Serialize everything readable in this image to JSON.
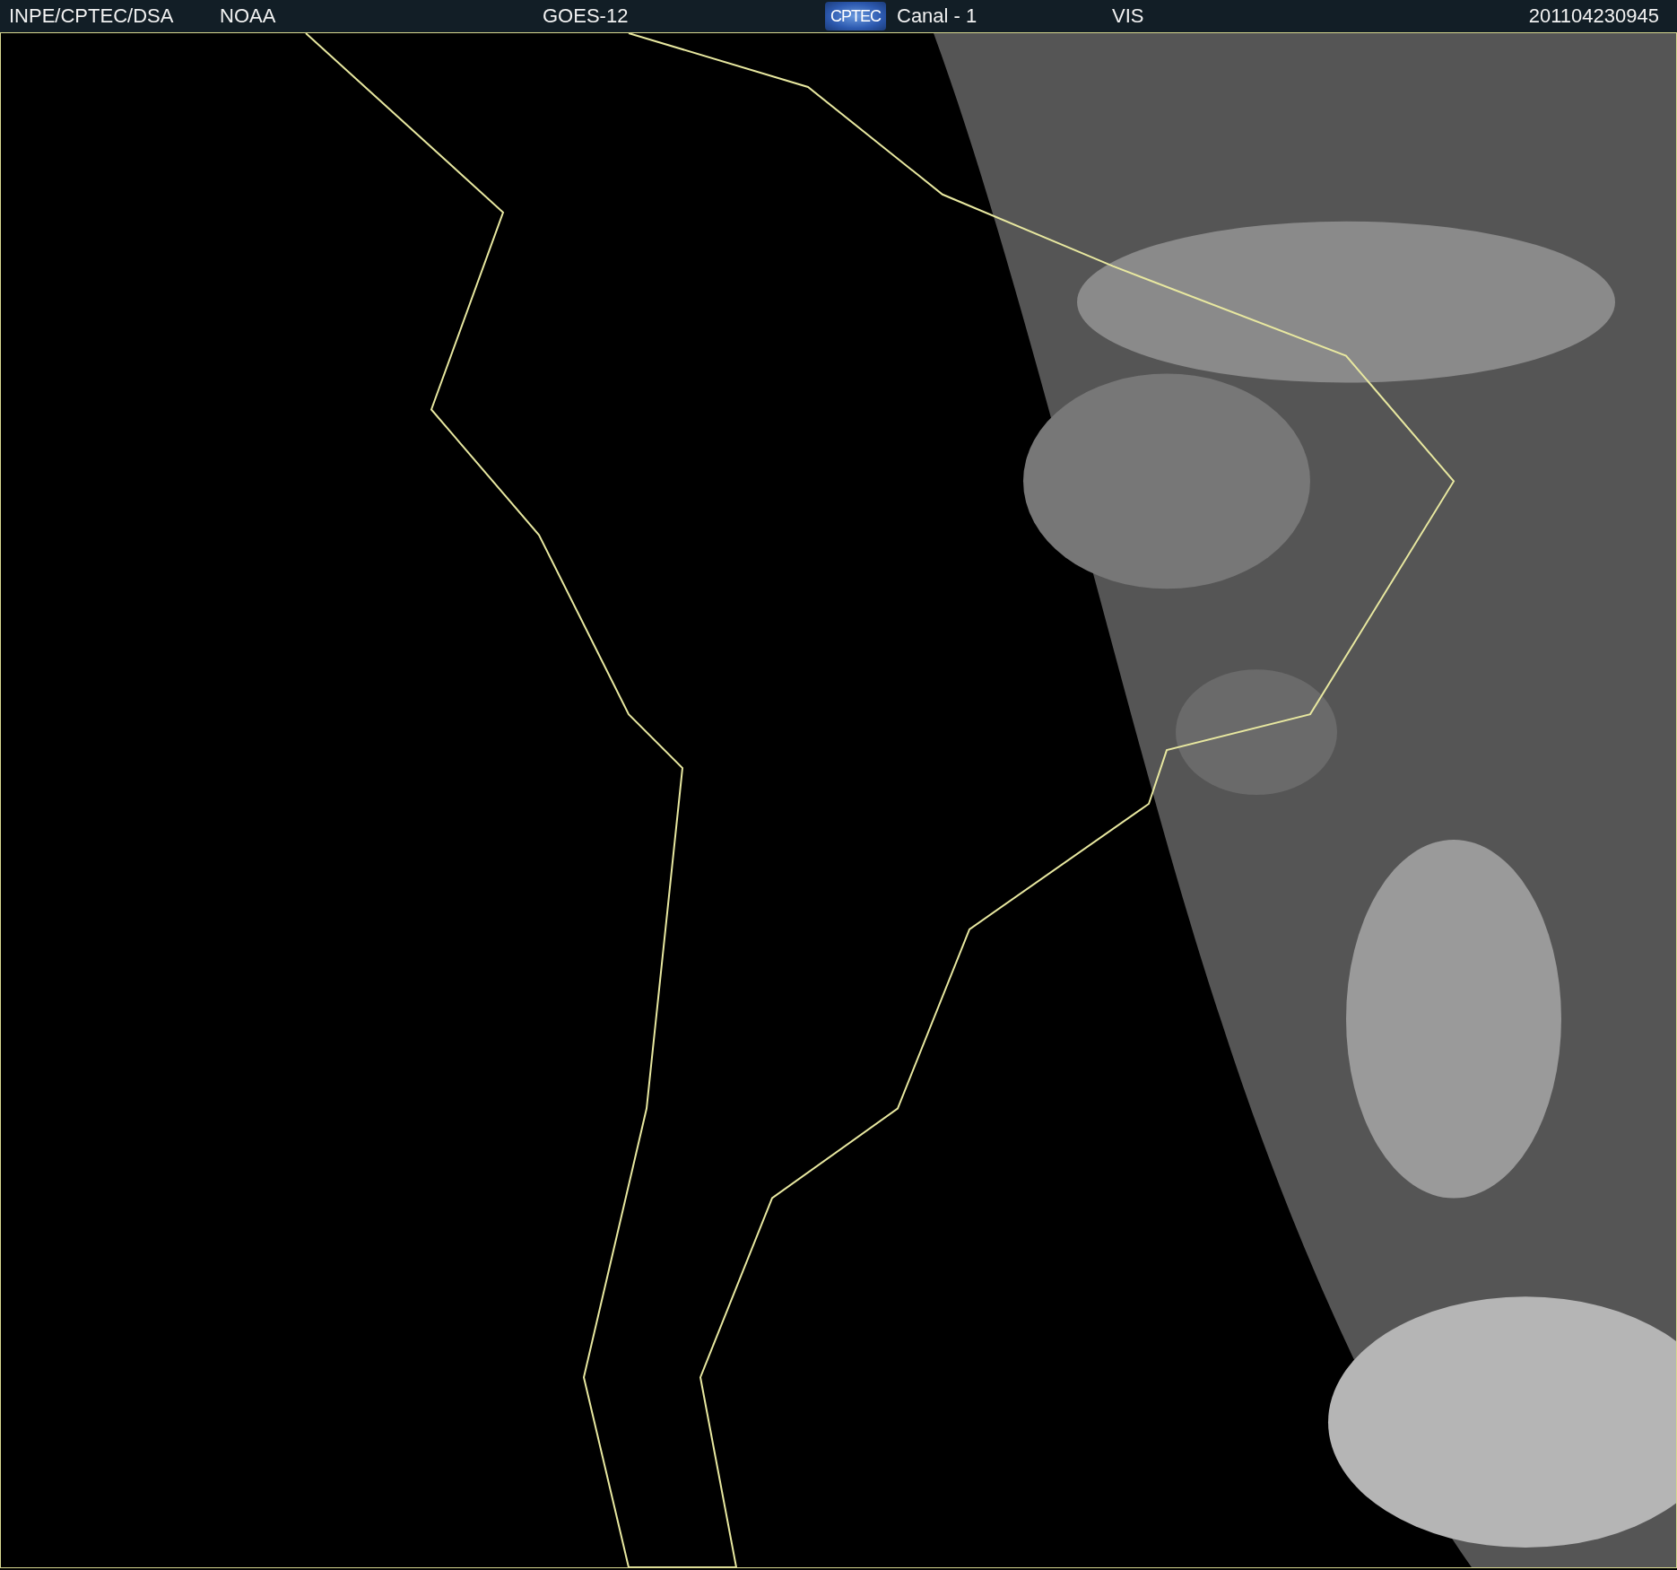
{
  "header": {
    "source": "INPE/CPTEC/DSA",
    "agency": "NOAA",
    "satellite": "GOES-12",
    "logo_text": "CPTEC",
    "channel": "Canal - 1",
    "band": "VIS",
    "timestamp": "201104230945"
  }
}
